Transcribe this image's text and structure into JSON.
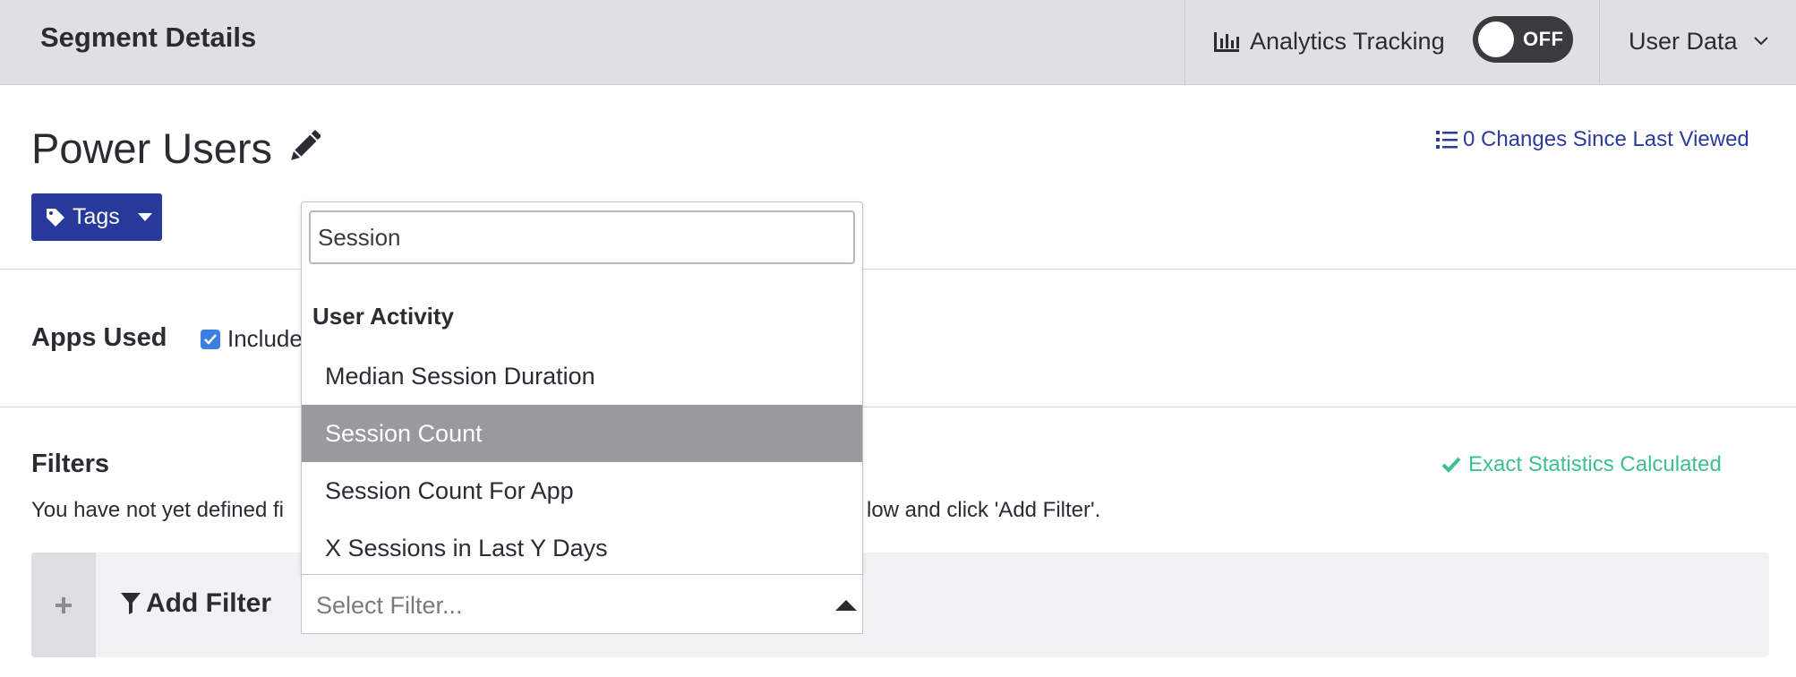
{
  "header": {
    "title": "Segment Details",
    "analytics_label": "Analytics Tracking",
    "toggle_state": "OFF",
    "user_data_label": "User Data"
  },
  "segment": {
    "name": "Power Users",
    "changes_link": "0 Changes Since Last Viewed",
    "tags_label": "Tags"
  },
  "apps_used": {
    "label": "Apps Used",
    "include_label": "Include",
    "include_checked": true
  },
  "filters": {
    "label": "Filters",
    "description_start": "You have not yet defined fi",
    "description_end": "low and click 'Add Filter'.",
    "stats_status": "Exact Statistics Calculated",
    "add_filter_label": "Add Filter",
    "select_placeholder": "Select Filter..."
  },
  "dropdown": {
    "search_value": "Session",
    "group_label": "User Activity",
    "options": [
      {
        "label": "Median Session Duration",
        "highlighted": false
      },
      {
        "label": "Session Count",
        "highlighted": true
      },
      {
        "label": "Session Count For App",
        "highlighted": false
      },
      {
        "label": "X Sessions in Last Y Days",
        "highlighted": false
      }
    ]
  },
  "icons": {
    "analytics": "bar-chart-icon",
    "user_data": "chevron-down-icon",
    "edit": "pencil-icon",
    "changes": "list-icon",
    "tags": "tag-icon",
    "tags_caret": "caret-down-icon",
    "include": "checkbox-checked-icon",
    "stats": "checkmark-icon",
    "add": "plus-icon",
    "add_filter": "filter-icon",
    "select": "caret-up-icon"
  },
  "colors": {
    "header_bg": "#e0e0e4",
    "primary": "#27399b",
    "link": "#2b3b9e",
    "success": "#3dbf8f",
    "highlight": "#9a9a9e",
    "checkbox": "#3b7fe0"
  }
}
